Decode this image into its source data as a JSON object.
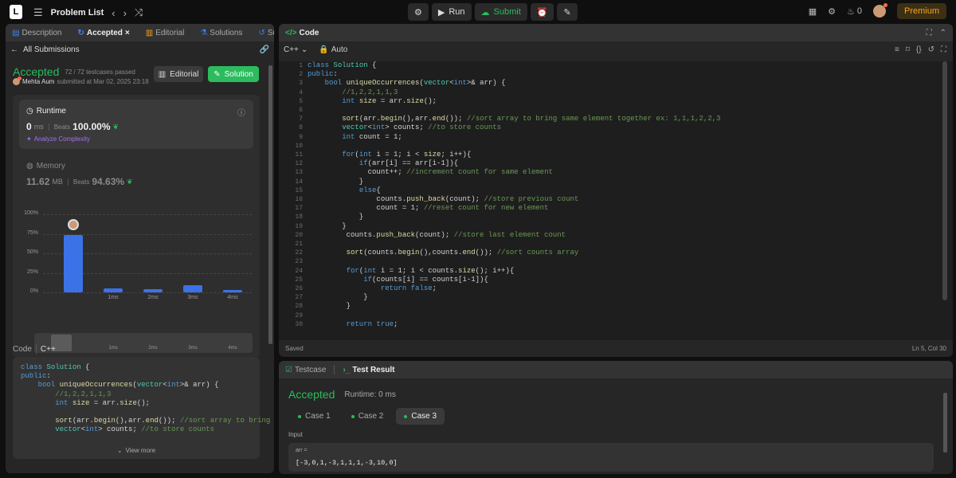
{
  "topbar": {
    "title": "Problem List",
    "run": "Run",
    "submit": "Submit",
    "premium": "Premium",
    "count": "0"
  },
  "left_tabs": [
    "Description",
    "Accepted",
    "Editorial",
    "Solutions",
    "Submissions"
  ],
  "all_submissions": "All Submissions",
  "submission": {
    "status": "Accepted",
    "testcases": "72 / 72 testcases passed",
    "user": "Mehta Aum",
    "submitted": "submitted at Mar 02, 2025 23:18",
    "editorial": "Editorial",
    "solution": "Solution"
  },
  "runtime": {
    "label": "Runtime",
    "value": "0",
    "unit": "ms",
    "beats_label": "Beats",
    "beats": "100.00%",
    "analyze": "Analyze Complexity"
  },
  "memory": {
    "label": "Memory",
    "value": "11.62",
    "unit": "MB",
    "beats_label": "Beats",
    "beats": "94.63%"
  },
  "chart_data": {
    "type": "bar",
    "categories": [
      "0ms",
      "1ms",
      "2ms",
      "3ms",
      "4ms"
    ],
    "values": [
      73,
      5,
      4,
      9,
      3
    ],
    "yticks": [
      "100%",
      "75%",
      "50%",
      "25%",
      "0%"
    ],
    "xticks": [
      "1ms",
      "2ms",
      "3ms",
      "4ms"
    ],
    "ylim": [
      0,
      100
    ]
  },
  "code_lang": {
    "label": "Code",
    "lang": "C++"
  },
  "left_code": [
    "class Solution {",
    "public:",
    "    bool uniqueOccurrences(vector<int>& arr) {",
    "        //1,2,2,1,1,3",
    "        int size = arr.size();",
    "",
    "        sort(arr.begin(),arr.end()); //sort array to bring",
    "        vector<int> counts; //to store counts"
  ],
  "view_more": "View more",
  "editor": {
    "title": "Code",
    "lang": "C++",
    "auto": "Auto",
    "saved": "Saved",
    "position": "Ln 5, Col 30"
  },
  "editor_lines": [
    "class Solution {",
    "public:",
    "    bool uniqueOccurrences(vector<int>& arr) {",
    "        //1,2,2,1,1,3",
    "        int size = arr.size();",
    "",
    "        sort(arr.begin(),arr.end()); //sort array to bring same element together ex: 1,1,1,2,2,3",
    "        vector<int> counts; //to store counts",
    "        int count = 1;",
    "",
    "        for(int i = 1; i < size; i++){",
    "            if(arr[i] == arr[i-1]){",
    "              count++; //increment count for same element",
    "            }",
    "            else{",
    "                counts.push_back(count); //store previous count",
    "                count = 1; //reset count for new element",
    "            }",
    "        }",
    "         counts.push_back(count); //store last element count",
    "",
    "         sort(counts.begin(),counts.end()); //sort counts array",
    "",
    "         for(int i = 1; i < counts.size(); i++){",
    "             if(counts[i] == counts[i-1]){",
    "                 return false;",
    "             }",
    "         }",
    "",
    "         return true;"
  ],
  "test": {
    "testcase": "Testcase",
    "result": "Test Result",
    "status": "Accepted",
    "runtime": "Runtime: 0 ms",
    "cases": [
      "Case 1",
      "Case 2",
      "Case 3"
    ],
    "input_label": "Input",
    "var": "arr =",
    "value": "[-3,0,1,-3,1,1,1,-3,10,0]"
  }
}
